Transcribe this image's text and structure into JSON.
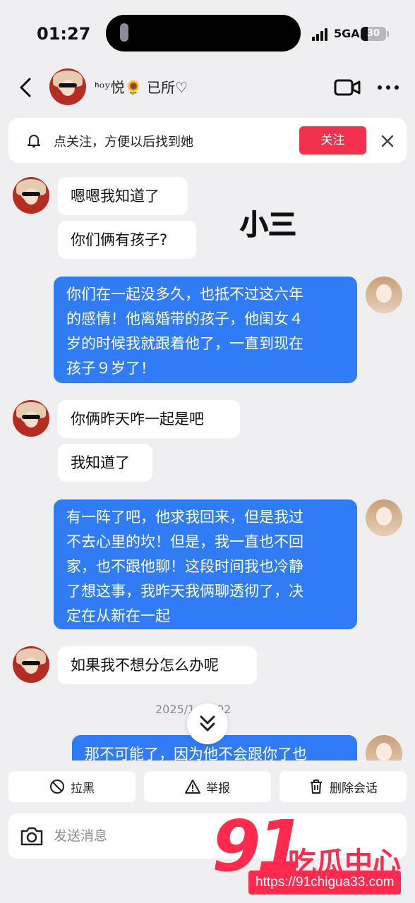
{
  "status_bar": {
    "time": "01:27",
    "network": "5GA",
    "battery": "30"
  },
  "header": {
    "contact_name": "ᑋᵒʸ悦🌻 已所♡"
  },
  "follow_banner": {
    "text": "点关注，方便以后找到她",
    "follow_label": "关注"
  },
  "overlay_label": "小三",
  "messages": [
    {
      "side": "in",
      "text": "嗯嗯我知道了"
    },
    {
      "side": "in",
      "text": "你们俩有孩子?"
    },
    {
      "side": "out",
      "lines": [
        "你们在一起没多久，也抵不过这六年",
        "的感情！他离婚带的孩子，他闺女４",
        "岁的时候我就跟着他了，一直到现在",
        "孩子９岁了！"
      ]
    },
    {
      "side": "in",
      "text": "你俩昨天咋一起是吧"
    },
    {
      "side": "in",
      "text": "我知道了"
    },
    {
      "side": "out",
      "lines": [
        "有一阵了吧，他求我回来，但是我过",
        "不去心里的坎！但是，我一直也不回",
        "家，也不跟他聊！这段时间我也冷静",
        "了想这事，我昨天我俩聊透彻了，决",
        "定在从新在一起"
      ]
    },
    {
      "side": "in",
      "text": "如果我不想分怎么办呢"
    },
    {
      "side": "out",
      "text": "那不可能了，因为他不会跟你了也"
    }
  ],
  "timestamp": "2025/1   18:02",
  "actions": {
    "block": "拉黑",
    "report": "举报",
    "delete": "删除会话"
  },
  "composer": {
    "placeholder": "发送消息"
  },
  "watermark": {
    "number": "91",
    "brand": "吃瓜中心",
    "url": "https://91chigua33.com"
  },
  "colors": {
    "outgoing_bubble": "#2f7cf6",
    "follow_button": "#f2314d",
    "watermark": "#ff2a4e"
  }
}
